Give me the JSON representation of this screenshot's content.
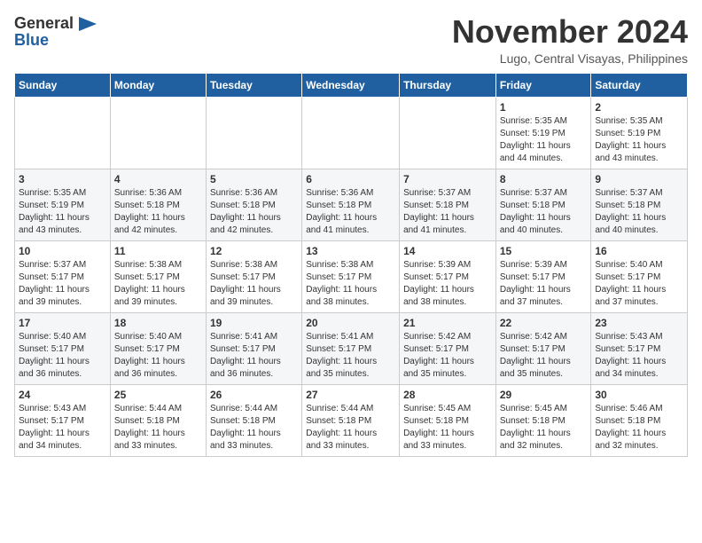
{
  "header": {
    "logo_line1": "General",
    "logo_line2": "Blue",
    "month_title": "November 2024",
    "location": "Lugo, Central Visayas, Philippines"
  },
  "weekdays": [
    "Sunday",
    "Monday",
    "Tuesday",
    "Wednesday",
    "Thursday",
    "Friday",
    "Saturday"
  ],
  "weeks": [
    [
      {
        "day": "",
        "info": ""
      },
      {
        "day": "",
        "info": ""
      },
      {
        "day": "",
        "info": ""
      },
      {
        "day": "",
        "info": ""
      },
      {
        "day": "",
        "info": ""
      },
      {
        "day": "1",
        "info": "Sunrise: 5:35 AM\nSunset: 5:19 PM\nDaylight: 11 hours\nand 44 minutes."
      },
      {
        "day": "2",
        "info": "Sunrise: 5:35 AM\nSunset: 5:19 PM\nDaylight: 11 hours\nand 43 minutes."
      }
    ],
    [
      {
        "day": "3",
        "info": "Sunrise: 5:35 AM\nSunset: 5:19 PM\nDaylight: 11 hours\nand 43 minutes."
      },
      {
        "day": "4",
        "info": "Sunrise: 5:36 AM\nSunset: 5:18 PM\nDaylight: 11 hours\nand 42 minutes."
      },
      {
        "day": "5",
        "info": "Sunrise: 5:36 AM\nSunset: 5:18 PM\nDaylight: 11 hours\nand 42 minutes."
      },
      {
        "day": "6",
        "info": "Sunrise: 5:36 AM\nSunset: 5:18 PM\nDaylight: 11 hours\nand 41 minutes."
      },
      {
        "day": "7",
        "info": "Sunrise: 5:37 AM\nSunset: 5:18 PM\nDaylight: 11 hours\nand 41 minutes."
      },
      {
        "day": "8",
        "info": "Sunrise: 5:37 AM\nSunset: 5:18 PM\nDaylight: 11 hours\nand 40 minutes."
      },
      {
        "day": "9",
        "info": "Sunrise: 5:37 AM\nSunset: 5:18 PM\nDaylight: 11 hours\nand 40 minutes."
      }
    ],
    [
      {
        "day": "10",
        "info": "Sunrise: 5:37 AM\nSunset: 5:17 PM\nDaylight: 11 hours\nand 39 minutes."
      },
      {
        "day": "11",
        "info": "Sunrise: 5:38 AM\nSunset: 5:17 PM\nDaylight: 11 hours\nand 39 minutes."
      },
      {
        "day": "12",
        "info": "Sunrise: 5:38 AM\nSunset: 5:17 PM\nDaylight: 11 hours\nand 39 minutes."
      },
      {
        "day": "13",
        "info": "Sunrise: 5:38 AM\nSunset: 5:17 PM\nDaylight: 11 hours\nand 38 minutes."
      },
      {
        "day": "14",
        "info": "Sunrise: 5:39 AM\nSunset: 5:17 PM\nDaylight: 11 hours\nand 38 minutes."
      },
      {
        "day": "15",
        "info": "Sunrise: 5:39 AM\nSunset: 5:17 PM\nDaylight: 11 hours\nand 37 minutes."
      },
      {
        "day": "16",
        "info": "Sunrise: 5:40 AM\nSunset: 5:17 PM\nDaylight: 11 hours\nand 37 minutes."
      }
    ],
    [
      {
        "day": "17",
        "info": "Sunrise: 5:40 AM\nSunset: 5:17 PM\nDaylight: 11 hours\nand 36 minutes."
      },
      {
        "day": "18",
        "info": "Sunrise: 5:40 AM\nSunset: 5:17 PM\nDaylight: 11 hours\nand 36 minutes."
      },
      {
        "day": "19",
        "info": "Sunrise: 5:41 AM\nSunset: 5:17 PM\nDaylight: 11 hours\nand 36 minutes."
      },
      {
        "day": "20",
        "info": "Sunrise: 5:41 AM\nSunset: 5:17 PM\nDaylight: 11 hours\nand 35 minutes."
      },
      {
        "day": "21",
        "info": "Sunrise: 5:42 AM\nSunset: 5:17 PM\nDaylight: 11 hours\nand 35 minutes."
      },
      {
        "day": "22",
        "info": "Sunrise: 5:42 AM\nSunset: 5:17 PM\nDaylight: 11 hours\nand 35 minutes."
      },
      {
        "day": "23",
        "info": "Sunrise: 5:43 AM\nSunset: 5:17 PM\nDaylight: 11 hours\nand 34 minutes."
      }
    ],
    [
      {
        "day": "24",
        "info": "Sunrise: 5:43 AM\nSunset: 5:17 PM\nDaylight: 11 hours\nand 34 minutes."
      },
      {
        "day": "25",
        "info": "Sunrise: 5:44 AM\nSunset: 5:18 PM\nDaylight: 11 hours\nand 33 minutes."
      },
      {
        "day": "26",
        "info": "Sunrise: 5:44 AM\nSunset: 5:18 PM\nDaylight: 11 hours\nand 33 minutes."
      },
      {
        "day": "27",
        "info": "Sunrise: 5:44 AM\nSunset: 5:18 PM\nDaylight: 11 hours\nand 33 minutes."
      },
      {
        "day": "28",
        "info": "Sunrise: 5:45 AM\nSunset: 5:18 PM\nDaylight: 11 hours\nand 33 minutes."
      },
      {
        "day": "29",
        "info": "Sunrise: 5:45 AM\nSunset: 5:18 PM\nDaylight: 11 hours\nand 32 minutes."
      },
      {
        "day": "30",
        "info": "Sunrise: 5:46 AM\nSunset: 5:18 PM\nDaylight: 11 hours\nand 32 minutes."
      }
    ]
  ]
}
